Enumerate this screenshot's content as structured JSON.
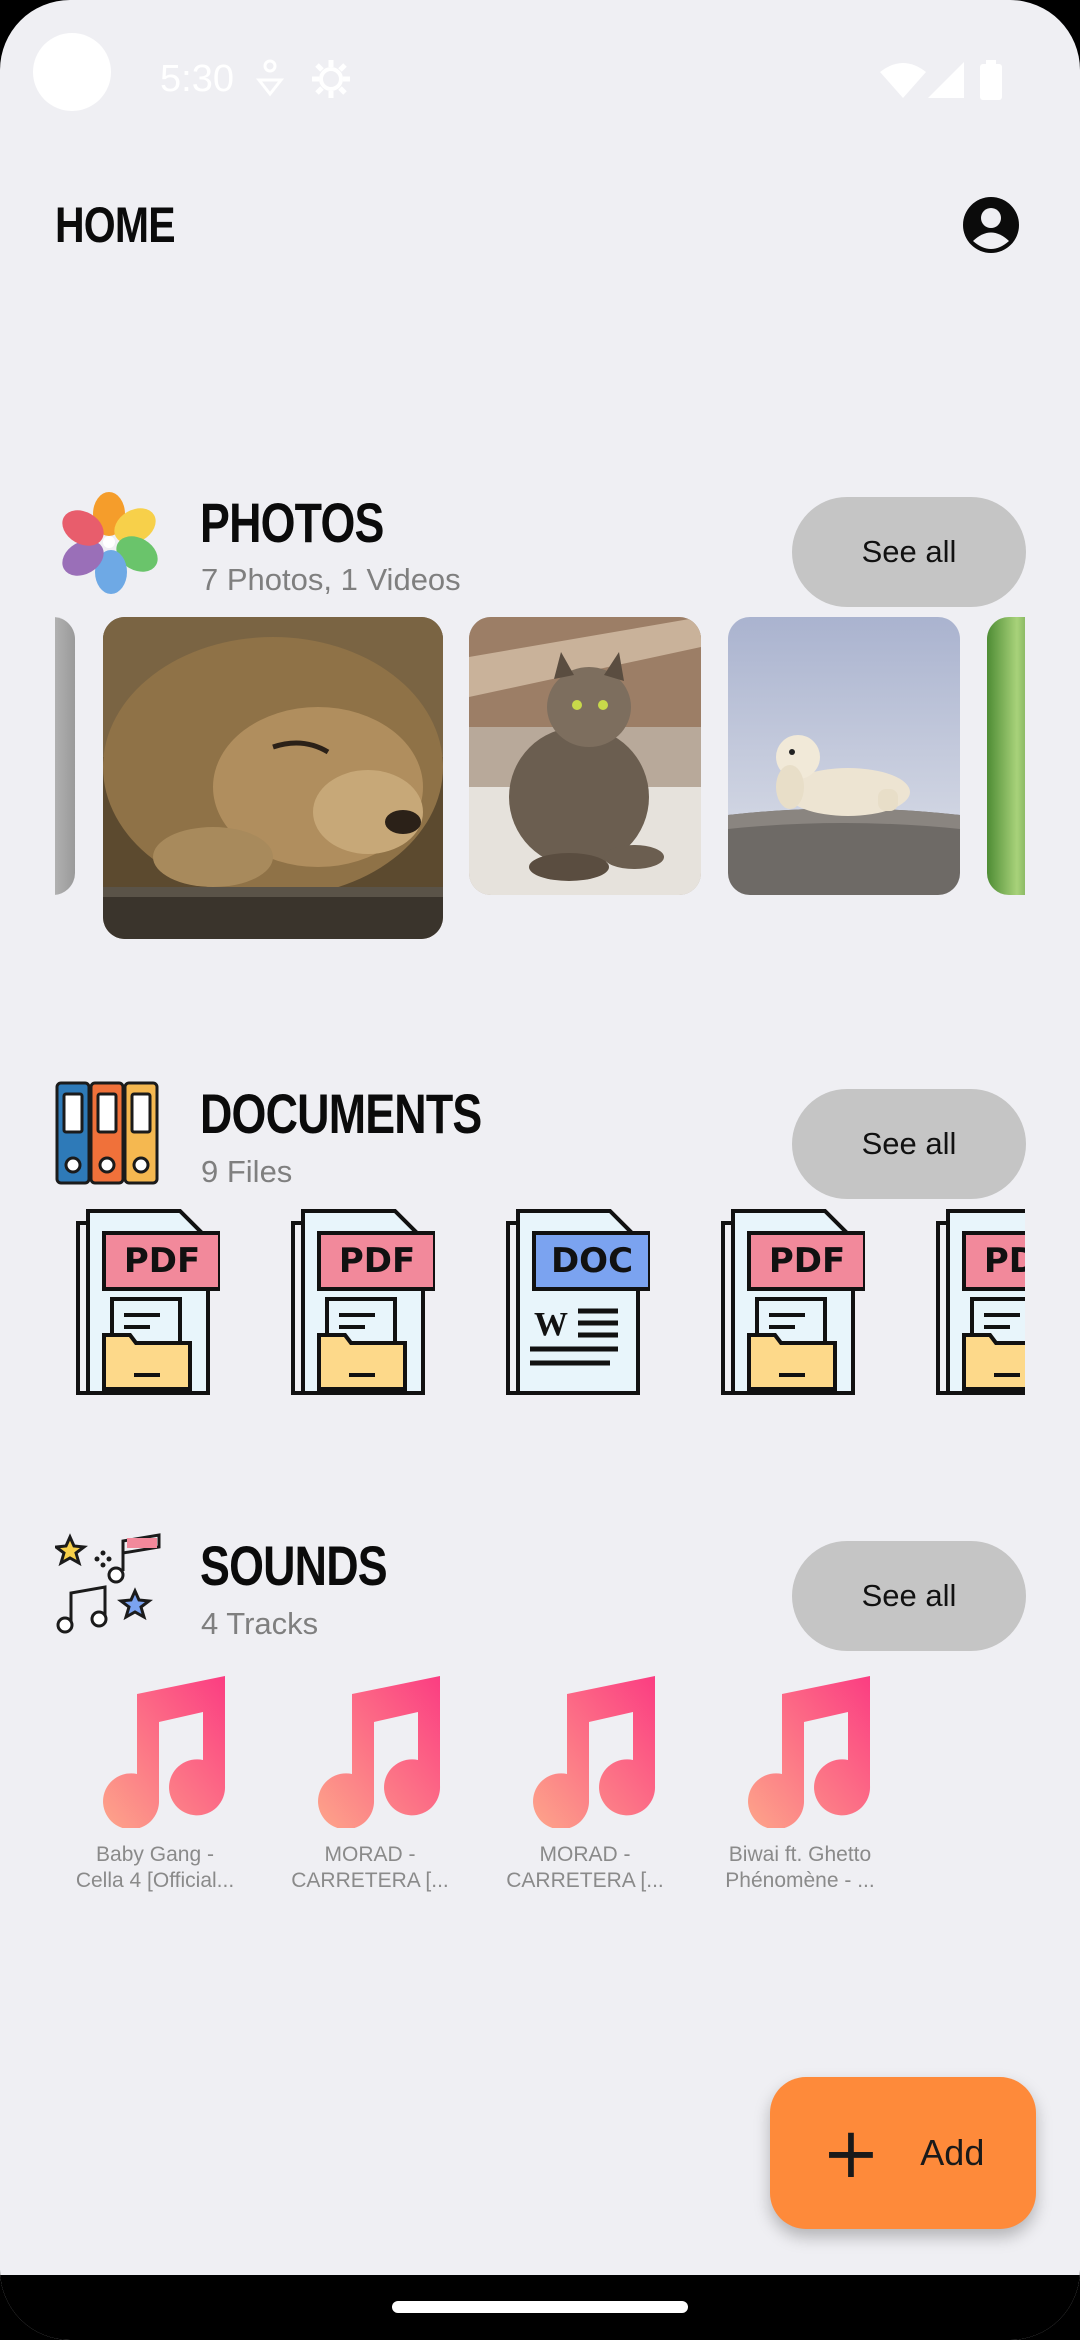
{
  "status_bar": {
    "time": "5:30"
  },
  "header": {
    "title": "HOME"
  },
  "photos": {
    "title": "PHOTOS",
    "subtitle": "7 Photos, 1 Videos",
    "see_all": "See all",
    "items": [
      "lion",
      "cat",
      "polar-bear"
    ]
  },
  "documents": {
    "title": "DOCUMENTS",
    "subtitle": "9 Files",
    "see_all": "See all",
    "files": [
      {
        "type": "PDF",
        "color": "#f2899b"
      },
      {
        "type": "PDF",
        "color": "#f2899b"
      },
      {
        "type": "DOC",
        "color": "#7ba3f0"
      },
      {
        "type": "PDF",
        "color": "#f2899b"
      },
      {
        "type": "PDF",
        "color": "#f2899b"
      }
    ]
  },
  "sounds": {
    "title": "SOUNDS",
    "subtitle": "4 Tracks",
    "see_all": "See all",
    "tracks": [
      {
        "line1": "Baby Gang -",
        "line2": "Cella 4 [Official..."
      },
      {
        "line1": "MORAD -",
        "line2": "CARRETERA [..."
      },
      {
        "line1": "MORAD -",
        "line2": "CARRETERA [..."
      },
      {
        "line1": "Biwai ft. Ghetto",
        "line2": "Phénomène - ..."
      }
    ]
  },
  "fab": {
    "label": "Add"
  },
  "colors": {
    "accent": "#fe8a3a",
    "background": "#efeff3",
    "button": "#c5c5c5"
  }
}
